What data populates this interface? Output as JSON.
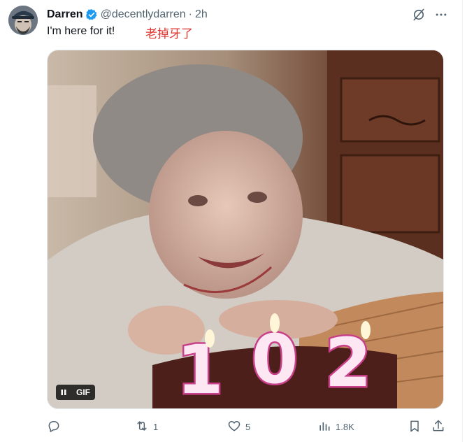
{
  "tweet": {
    "author_name": "Darren",
    "handle": "@decentlydarren",
    "separator": "·",
    "time": "2h",
    "text": "I'm here for it!",
    "annotation": "老掉牙了"
  },
  "media": {
    "badge_label": "GIF",
    "candle_digits": [
      "1",
      "0",
      "2"
    ]
  },
  "actions": {
    "reply_count": "",
    "retweet_count": "1",
    "like_count": "5",
    "views_count": "1.8K"
  },
  "colors": {
    "verified": "#1d9bf0",
    "annotation_red": "#e0342f",
    "muted": "#536471"
  },
  "icons": {
    "verified": "verified-badge-icon",
    "grok": "grok-icon",
    "more": "more-icon",
    "reply": "reply-icon",
    "retweet": "retweet-icon",
    "like": "like-icon",
    "views": "views-icon",
    "bookmark": "bookmark-icon",
    "share": "share-icon",
    "pause": "pause-icon"
  }
}
